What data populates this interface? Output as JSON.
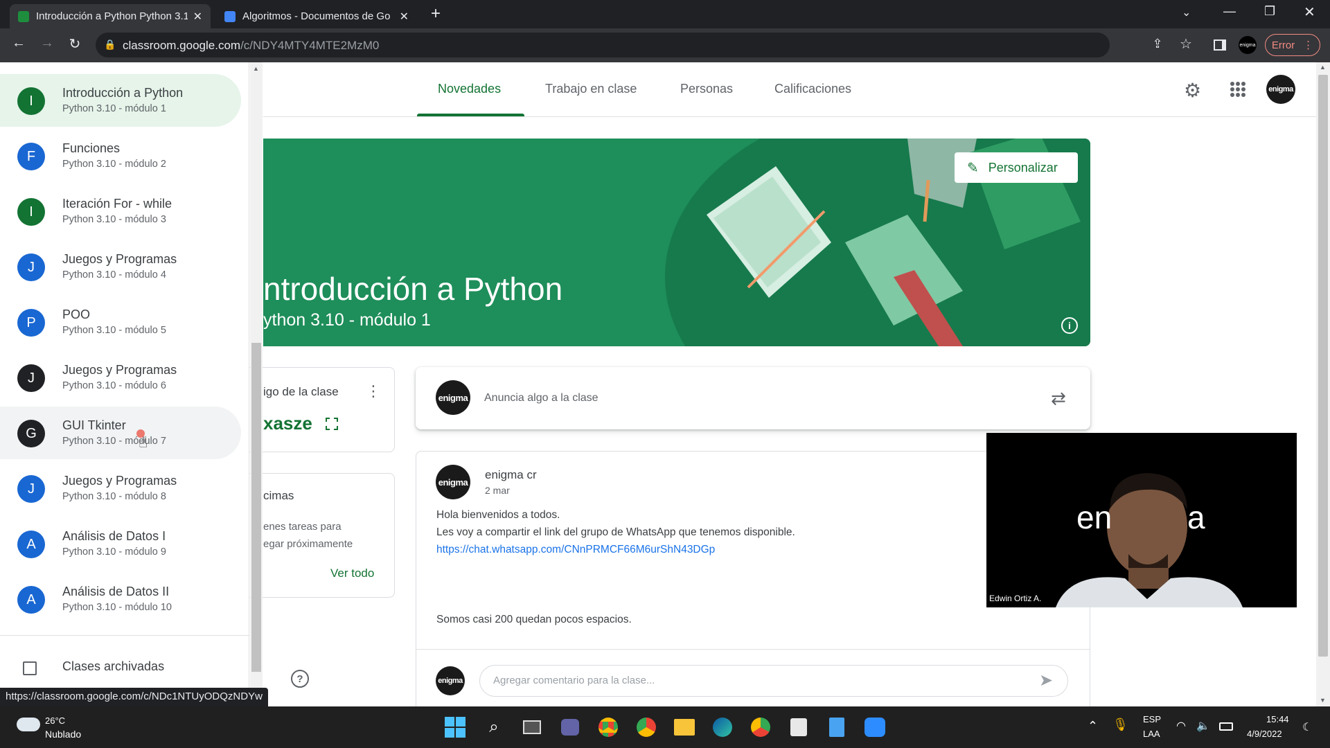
{
  "browser": {
    "tabs": [
      {
        "title": "Introducción a Python Python 3.1",
        "active": true
      },
      {
        "title": "Algoritmos - Documentos de Go",
        "active": false
      }
    ],
    "url_host": "classroom.google.com",
    "url_path": "/c/NDY4MTY4MTE2MzM0",
    "error_label": "Error",
    "profile_label": "enigma"
  },
  "drawer": {
    "items": [
      {
        "initial": "I",
        "title": "Introducción a Python",
        "subtitle": "Python 3.10 - módulo 1",
        "color": "#137333"
      },
      {
        "initial": "F",
        "title": "Funciones",
        "subtitle": "Python 3.10 - módulo 2",
        "color": "#1967d2"
      },
      {
        "initial": "I",
        "title": "Iteración For - while",
        "subtitle": "Python 3.10 - módulo 3",
        "color": "#137333"
      },
      {
        "initial": "J",
        "title": "Juegos y Programas",
        "subtitle": "Python 3.10 - módulo 4",
        "color": "#1967d2"
      },
      {
        "initial": "P",
        "title": "POO",
        "subtitle": "Python 3.10 - módulo 5",
        "color": "#1967d2"
      },
      {
        "initial": "J",
        "title": "Juegos y Programas",
        "subtitle": "Python 3.10 - módulo 6",
        "color": "#202124"
      },
      {
        "initial": "G",
        "title": "GUI Tkinter",
        "subtitle": "Python 3.10 - módulo 7",
        "color": "#202124"
      },
      {
        "initial": "J",
        "title": "Juegos y Programas",
        "subtitle": "Python 3.10 - módulo 8",
        "color": "#1967d2"
      },
      {
        "initial": "A",
        "title": "Análisis de Datos I",
        "subtitle": "Python 3.10 - módulo 9",
        "color": "#1967d2"
      },
      {
        "initial": "A",
        "title": "Análisis de Datos II",
        "subtitle": "Python 3.10 - módulo 10",
        "color": "#1967d2"
      }
    ],
    "archived_label": "Clases archivadas"
  },
  "nav": {
    "tabs": [
      "Novedades",
      "Trabajo en clase",
      "Personas",
      "Calificaciones"
    ],
    "active": "Novedades"
  },
  "banner": {
    "title": "ntroducción a Python",
    "subtitle": "ython 3.10 - módulo 1",
    "customize_label": "Personalizar"
  },
  "class_code": {
    "label": "igo de la clase",
    "code": "xasze"
  },
  "upcoming": {
    "title": "cimas",
    "line1": "enes tareas para",
    "line2": "egar próximamente",
    "view_all": "Ver todo"
  },
  "composer": {
    "placeholder": "Anuncia algo a la clase",
    "avatar_text": "enigma"
  },
  "post": {
    "author": "enigma cr",
    "date": "2 mar",
    "line1": "Hola bienvenidos a todos.",
    "line2": "Les voy a compartir el link del grupo de WhatsApp que tenemos disponible.",
    "link": "https://chat.whatsapp.com/CNnPRMCF66M6urShN43DGp",
    "line3": "Somos casi 200 quedan pocos espacios.",
    "comment_placeholder": "Agregar comentario para la clase..."
  },
  "video": {
    "overlay_text_left": "en",
    "overlay_text_right": "a",
    "name": "Edwin Ortiz A."
  },
  "status_url": "https://classroom.google.com/c/NDc1NTUyODQzNDYw",
  "taskbar": {
    "weather_temp": "26°C",
    "weather_desc": "Nublado",
    "lang1": "ESP",
    "lang2": "LAA",
    "time": "15:44",
    "date": "4/9/2022"
  },
  "colors": {
    "classroom_green": "#137333",
    "banner_green": "#1e8e5a",
    "link_blue": "#1a73e8"
  }
}
